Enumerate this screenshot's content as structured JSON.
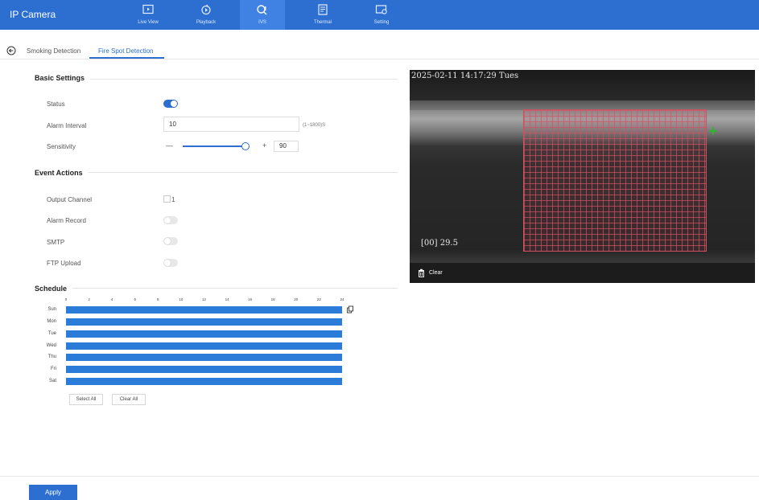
{
  "app": {
    "title": "IP Camera"
  },
  "nav": [
    {
      "label": "Live View",
      "icon": "live-view-icon"
    },
    {
      "label": "Playback",
      "icon": "playback-icon"
    },
    {
      "label": "IVS",
      "icon": "ivs-icon",
      "active": true
    },
    {
      "label": "Thermal",
      "icon": "thermal-icon"
    },
    {
      "label": "Setting",
      "icon": "setting-icon"
    }
  ],
  "tabs": [
    {
      "label": "Smoking Detection"
    },
    {
      "label": "Fire Spot Detection",
      "active": true
    }
  ],
  "basic": {
    "title": "Basic Settings",
    "status_label": "Status",
    "status_on": true,
    "interval_label": "Alarm Interval",
    "interval_value": "10",
    "interval_hint": "(1~1800)S",
    "sensitivity_label": "Sensitivity",
    "sensitivity_minus": "—",
    "sensitivity_plus": "+",
    "sensitivity_value": "90"
  },
  "events": {
    "title": "Event Actions",
    "output_label": "Output Channel",
    "output_channel": "1",
    "alarm_record_label": "Alarm Record",
    "alarm_record_on": false,
    "smtp_label": "SMTP",
    "smtp_on": false,
    "ftp_label": "FTP Upload",
    "ftp_on": false
  },
  "schedule": {
    "title": "Schedule",
    "hours": [
      "0",
      "2",
      "4",
      "6",
      "8",
      "10",
      "12",
      "14",
      "16",
      "18",
      "20",
      "22",
      "24"
    ],
    "days": [
      "Sun",
      "Mon",
      "Tue",
      "Wed",
      "Thu",
      "Fri",
      "Sat"
    ],
    "select_all": "Select All",
    "clear_all": "Clear All"
  },
  "video": {
    "timestamp": "2025-02-11 14:17:29 Tues",
    "temp_readout": "[00] 29.5",
    "clear_label": "Clear"
  },
  "colors": {
    "primary": "#2c6fd1",
    "schedule_bar": "#2b7bd8",
    "grid": "#d65064"
  },
  "apply_label": "Apply"
}
